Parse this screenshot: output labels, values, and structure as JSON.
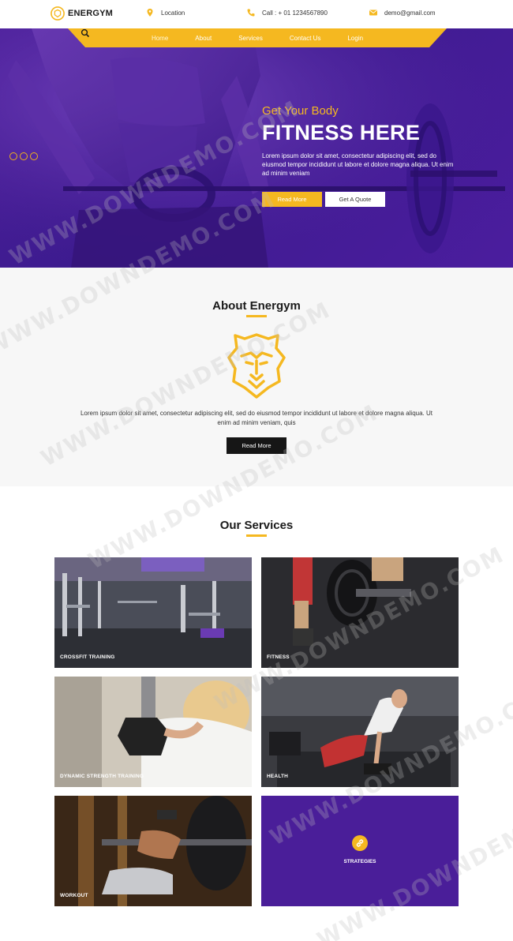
{
  "brand": {
    "name": "ENERGYM",
    "accent": "#f5b820",
    "purple": "#4a1e99"
  },
  "topbar": {
    "location": "Location",
    "phone": "Call : + 01 1234567890",
    "email": "demo@gmail.com"
  },
  "nav": {
    "items": [
      "Home",
      "About",
      "Services",
      "Contact Us",
      "Login"
    ],
    "active": "Home",
    "search_icon": "search-icon"
  },
  "hero": {
    "subtitle": "Get Your Body",
    "title": "FITNESS HERE",
    "text": "Lorem ipsum dolor sit amet, consectetur adipiscing elit, sed do eiusmod tempor incididunt ut labore et dolore magna aliqua. Ut enim ad minim veniam",
    "read_more": "Read More",
    "quote": "Get A Quote",
    "slide_count": 3
  },
  "about": {
    "title": "About Energym",
    "text": "Lorem ipsum dolor sit amet, consectetur adipiscing elit, sed do eiusmod tempor incididunt ut labore et dolore magna aliqua. Ut enim ad minim veniam, quis",
    "button": "Read More"
  },
  "services": {
    "title": "Our Services",
    "cards": [
      {
        "label": "CROSSFIT TRAINING"
      },
      {
        "label": "FITNESS"
      },
      {
        "label": "DYNAMIC STRENGTH TRAINING"
      },
      {
        "label": "HEALTH"
      },
      {
        "label": "WORKOUT"
      },
      {
        "label": "STRATEGIES",
        "icon": "link-icon"
      }
    ]
  },
  "watermark": "WWW.DOWNDEMO.COM"
}
